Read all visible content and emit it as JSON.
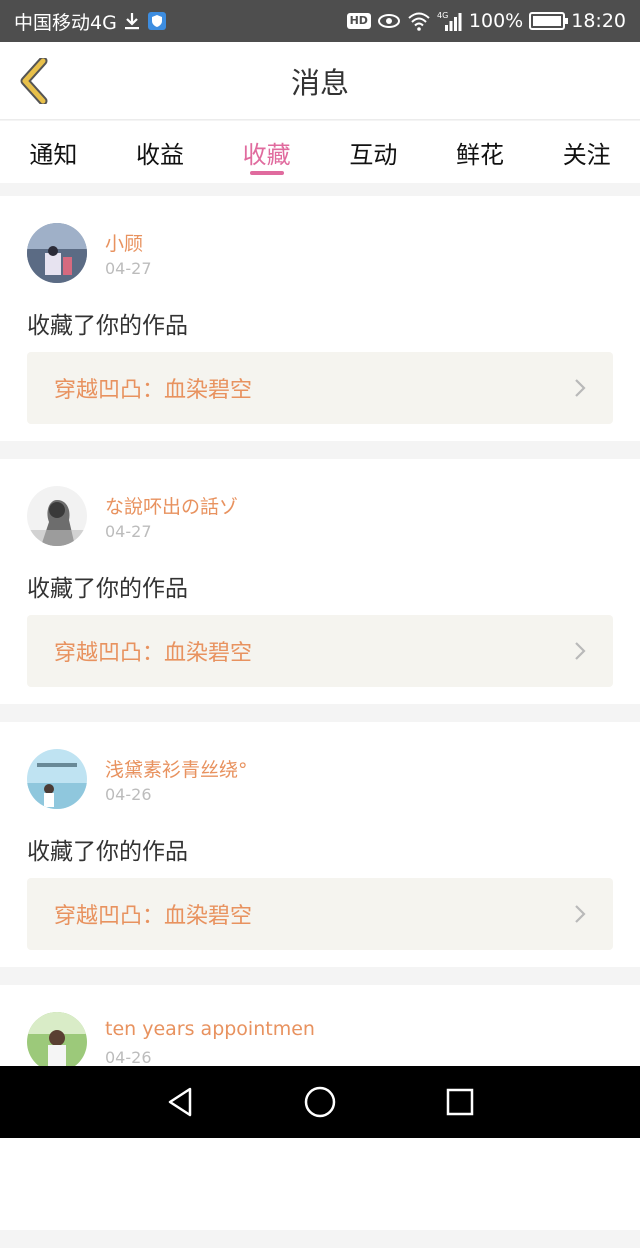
{
  "status_bar": {
    "carrier": "中国移动4G",
    "network_label": "4G",
    "battery": "100%",
    "time": "18:20",
    "icons": [
      "download-icon",
      "shield-icon",
      "hd-icon",
      "eye-icon",
      "wifi-icon",
      "signal-icon",
      "battery-icon"
    ]
  },
  "header": {
    "title": "消息",
    "back_icon": "chevron-left-icon"
  },
  "tabs": [
    {
      "label": "通知",
      "active": false
    },
    {
      "label": "收益",
      "active": false
    },
    {
      "label": "收藏",
      "active": true
    },
    {
      "label": "互动",
      "active": false
    },
    {
      "label": "鲜花",
      "active": false
    },
    {
      "label": "关注",
      "active": false
    }
  ],
  "messages": [
    {
      "username": "小顾",
      "date": "04-27",
      "action": "收藏了你的作品",
      "work": "穿越凹凸：血染碧空"
    },
    {
      "username": "な說吥出の話ゾ",
      "date": "04-27",
      "action": "收藏了你的作品",
      "work": "穿越凹凸：血染碧空"
    },
    {
      "username": "浅黛素衫青丝绕°",
      "date": "04-26",
      "action": "收藏了你的作品",
      "work": "穿越凹凸：血染碧空"
    },
    {
      "username": "ten years appointmen",
      "date": "04-26",
      "action": "",
      "work": ""
    }
  ],
  "nav_bar": {
    "icons": [
      "back-triangle-icon",
      "home-circle-icon",
      "recents-square-icon"
    ]
  },
  "colors": {
    "accent_pink": "#e06b9e",
    "username_orange": "#e8925f",
    "status_bar_bg": "#4e4e4e",
    "back_chevron": "#e8c04a"
  }
}
